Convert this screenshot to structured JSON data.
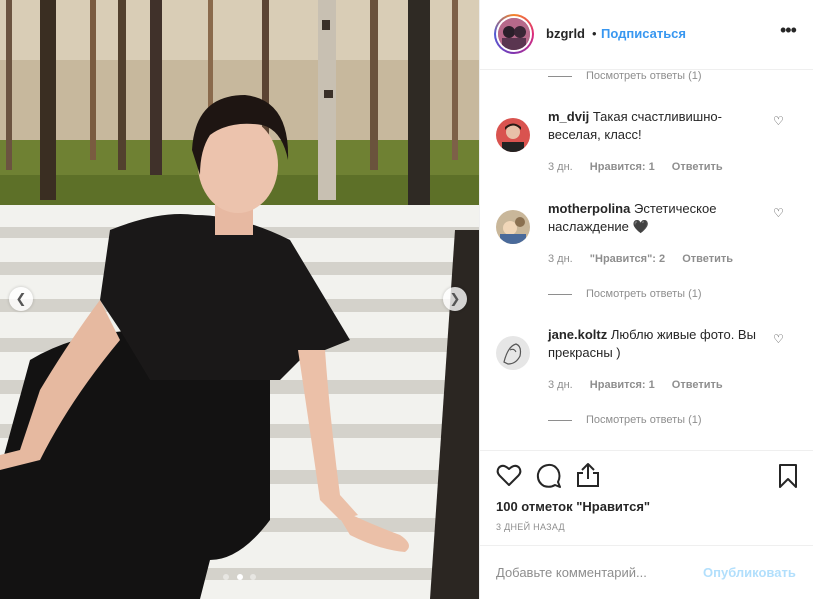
{
  "post": {
    "username": "bzgrld",
    "separator": "•",
    "follow_label": "Подписаться",
    "options_icon": "more-horizontal-icon",
    "slide_index": 2,
    "slide_count": 3
  },
  "comments": [
    {
      "view_replies": "Посмотреть ответы (1)"
    },
    {
      "username": "m_dvij",
      "text": "Такая счастливишно-веселая, класс!",
      "age": "3 дн.",
      "likes": "Нравится: 1",
      "reply": "Ответить"
    },
    {
      "username": "motherpolina",
      "text": "Эстетическое наслаждение 🖤",
      "age": "3 дн.",
      "likes": "\"Нравится\": 2",
      "reply": "Ответить",
      "view_replies": "Посмотреть ответы (1)"
    },
    {
      "username": "jane.koltz",
      "text": "Люблю живые фото. Вы прекрасны )",
      "age": "3 дн.",
      "likes": "Нравится: 1",
      "reply": "Ответить",
      "view_replies": "Посмотреть ответы (1)"
    }
  ],
  "footer": {
    "likes_text": "100 отметок \"Нравится\"",
    "timestamp": "3 дней назад",
    "comment_placeholder": "Добавьте комментарий...",
    "publish_label": "Опубликовать"
  },
  "colors": {
    "accent": "#3897f0",
    "muted": "#8e8e8e",
    "publish_disabled": "#b2dffc"
  }
}
